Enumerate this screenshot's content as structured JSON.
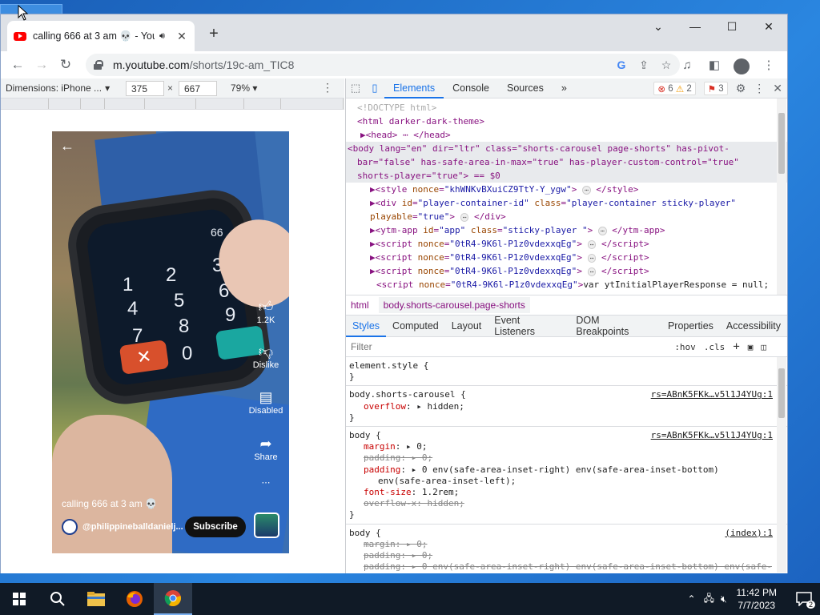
{
  "browser": {
    "tab_title": "calling 666 at 3 am 💀 - You",
    "url_host": "m.youtube.com",
    "url_path": "/shorts/19c-am_TIC8",
    "new_tab": "+"
  },
  "device_toolbar": {
    "device": "Dimensions: iPhone ...",
    "width": "375",
    "times": "×",
    "height": "667",
    "zoom": "79%"
  },
  "short": {
    "keys": [
      "1",
      "2",
      "3",
      "4",
      "5",
      "6",
      "7",
      "8",
      "9",
      "0",
      "66"
    ],
    "like_count": "1.2K",
    "dislike_label": "Dislike",
    "disabled_label": "Disabled",
    "share_label": "Share",
    "more": "⋯",
    "title": "calling 666 at 3 am 💀",
    "channel": "@philippineballdanielj...",
    "subscribe": "Subscribe"
  },
  "devtools": {
    "tabs": [
      "Elements",
      "Console",
      "Sources"
    ],
    "more_tabs": "»",
    "errors": "6",
    "warnings": "2",
    "issues": "3",
    "crumb_html": "html",
    "crumb_body": "body.shorts-carousel.page-shorts",
    "style_tabs": [
      "Styles",
      "Computed",
      "Layout",
      "Event Listeners",
      "DOM Breakpoints",
      "Properties",
      "Accessibility"
    ],
    "filter_placeholder": "Filter",
    "hov": ":hov",
    "cls": ".cls",
    "plus": "+"
  },
  "elements_lines": [
    {
      "kind": "comment",
      "text": "<!DOCTYPE html>"
    },
    {
      "kind": "html",
      "text": "<html darker-dark-theme>"
    },
    {
      "kind": "head",
      "text": "▶<head> ⋯ </head>"
    },
    {
      "kind": "body",
      "text": "<body lang=\"en\" dir=\"ltr\" class=\"shorts-carousel page-shorts\" has-pivot-bar=\"false\" has-safe-area-in-max=\"true\" has-player-custom-control=\"true\" shorts-player=\"true\"> == $0"
    }
  ],
  "styles": {
    "element_style": "element.style {",
    "close": "}",
    "rule1_selector": "body.shorts-carousel {",
    "rule1_src": "rs=ABnK5FKk…v5l1J4YUg:1",
    "rule1_prop": "overflow",
    "rule1_val": "hidden;",
    "rule2_selector": "body {",
    "rule2_src": "rs=ABnK5FKk…v5l1J4YUg:1",
    "rule3_selector": "body {",
    "rule3_src": "(index):1"
  },
  "taskbar": {
    "time": "11:42 PM",
    "date": "7/7/2023",
    "notif_count": "2"
  }
}
